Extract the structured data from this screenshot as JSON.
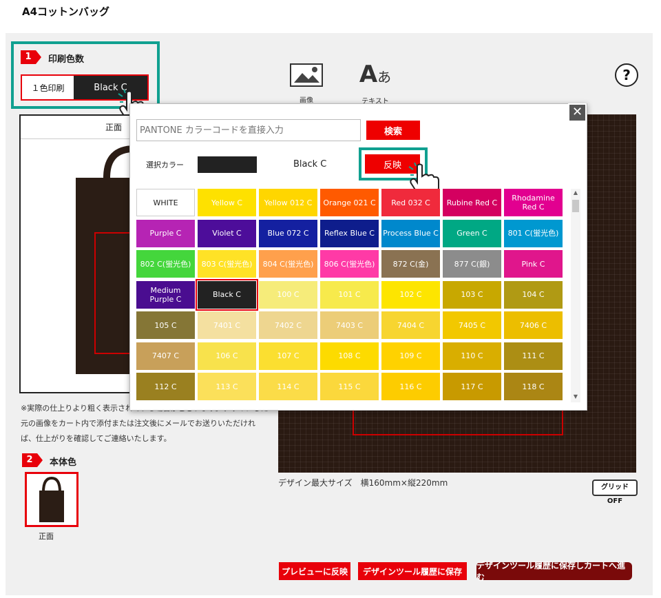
{
  "page": {
    "title": "A4コットンバッグ"
  },
  "step1": {
    "number": "1",
    "label": "印刷色数",
    "option_single": "１色印刷",
    "current_color": "Black C"
  },
  "step2": {
    "number": "2",
    "label": "本体色",
    "thumb_caption": "正面"
  },
  "tools": {
    "image_label": "画像",
    "text_label": "テキスト",
    "text_glyph": "A",
    "text_glyph_small": "あ",
    "help": "?"
  },
  "preview": {
    "tab_label": "正面"
  },
  "note": {
    "text": "※実際の仕上りより粗く表示されている場合がございます。デザインした元の画像をカート内で添付または注文後にメールでお送りいただければ、仕上がりを確認してご連絡いたします。"
  },
  "canvas": {
    "design_size": "デザイン最大サイズ　横160mm×縦220mm",
    "grid_button": "グリッドOFF"
  },
  "buttons": {
    "preview": "プレビューに反映",
    "save": "デザインツール履歴に保存",
    "save_cart": "デザインツール履歴に保存しカートへ進む"
  },
  "modal": {
    "close": "✕",
    "input_placeholder": "PANTONE カラーコードを直接入力",
    "search": "検索",
    "selected_label": "選択カラー",
    "selected_name": "Black C",
    "apply": "反映",
    "swatches": [
      {
        "label": "WHITE",
        "bg": "#ffffff",
        "fg": "#222222"
      },
      {
        "label": "Yellow C",
        "bg": "#fee100",
        "fg": "#ffffff"
      },
      {
        "label": "Yellow 012 C",
        "bg": "#ffd600",
        "fg": "#ffffff"
      },
      {
        "label": "Orange 021 C",
        "bg": "#ff5a00",
        "fg": "#ffffff"
      },
      {
        "label": "Red 032 C",
        "bg": "#f02a3c",
        "fg": "#ffffff"
      },
      {
        "label": "Rubine Red C",
        "bg": "#d40060",
        "fg": "#ffffff"
      },
      {
        "label": "Rhodamine Red C",
        "bg": "#e20090",
        "fg": "#ffffff"
      },
      {
        "label": "Purple C",
        "bg": "#b624b4",
        "fg": "#ffffff"
      },
      {
        "label": "Violet C",
        "bg": "#4d0d9a",
        "fg": "#ffffff"
      },
      {
        "label": "Blue 072 C",
        "bg": "#1420a0",
        "fg": "#ffffff"
      },
      {
        "label": "Reflex Blue C",
        "bg": "#0e1d8c",
        "fg": "#ffffff"
      },
      {
        "label": "Process Blue C",
        "bg": "#0088cc",
        "fg": "#ffffff"
      },
      {
        "label": "Green C",
        "bg": "#00a884",
        "fg": "#ffffff"
      },
      {
        "label": "801 C(蛍光色)",
        "bg": "#0098d0",
        "fg": "#ffffff"
      },
      {
        "label": "802 C(蛍光色)",
        "bg": "#44d63c",
        "fg": "#ffffff"
      },
      {
        "label": "803 C(蛍光色)",
        "bg": "#ffe226",
        "fg": "#ffffff"
      },
      {
        "label": "804 C(蛍光色)",
        "bg": "#ffa04c",
        "fg": "#ffffff"
      },
      {
        "label": "806 C(蛍光色)",
        "bg": "#ff3aa6",
        "fg": "#ffffff"
      },
      {
        "label": "872 C(金)",
        "bg": "#8a7252",
        "fg": "#ffffff"
      },
      {
        "label": "877 C(銀)",
        "bg": "#8c8c8c",
        "fg": "#ffffff"
      },
      {
        "label": "Pink C",
        "bg": "#e0168c",
        "fg": "#ffffff"
      },
      {
        "label": "Medium Purple C",
        "bg": "#4a0d90",
        "fg": "#ffffff"
      },
      {
        "label": "Black C",
        "bg": "#222222",
        "fg": "#ffffff"
      },
      {
        "label": "100 C",
        "bg": "#f6ec7a",
        "fg": "#ffffff"
      },
      {
        "label": "101 C",
        "bg": "#f7ea4c",
        "fg": "#ffffff"
      },
      {
        "label": "102 C",
        "bg": "#fde500",
        "fg": "#ffffff"
      },
      {
        "label": "103 C",
        "bg": "#c8a800",
        "fg": "#ffffff"
      },
      {
        "label": "104 C",
        "bg": "#b09a14",
        "fg": "#ffffff"
      },
      {
        "label": "105 C",
        "bg": "#857636",
        "fg": "#ffffff"
      },
      {
        "label": "7401 C",
        "bg": "#f4e0a0",
        "fg": "#ffffff"
      },
      {
        "label": "7402 C",
        "bg": "#eed690",
        "fg": "#ffffff"
      },
      {
        "label": "7403 C",
        "bg": "#eccd78",
        "fg": "#ffffff"
      },
      {
        "label": "7404 C",
        "bg": "#f7d530",
        "fg": "#ffffff"
      },
      {
        "label": "7405 C",
        "bg": "#f2c800",
        "fg": "#ffffff"
      },
      {
        "label": "7406 C",
        "bg": "#ecbe00",
        "fg": "#ffffff"
      },
      {
        "label": "7407 C",
        "bg": "#c8a05a",
        "fg": "#ffffff"
      },
      {
        "label": "106 C",
        "bg": "#f8e24c",
        "fg": "#ffffff"
      },
      {
        "label": "107 C",
        "bg": "#fbdf30",
        "fg": "#ffffff"
      },
      {
        "label": "108 C",
        "bg": "#fddb00",
        "fg": "#ffffff"
      },
      {
        "label": "109 C",
        "bg": "#ffd200",
        "fg": "#ffffff"
      },
      {
        "label": "110 C",
        "bg": "#d9ae00",
        "fg": "#ffffff"
      },
      {
        "label": "111 C",
        "bg": "#ac8e14",
        "fg": "#ffffff"
      },
      {
        "label": "112 C",
        "bg": "#9a8020",
        "fg": "#ffffff"
      },
      {
        "label": "113 C",
        "bg": "#fbe05a",
        "fg": "#ffffff"
      },
      {
        "label": "114 C",
        "bg": "#fbdc48",
        "fg": "#ffffff"
      },
      {
        "label": "115 C",
        "bg": "#fbd83c",
        "fg": "#ffffff"
      },
      {
        "label": "116 C",
        "bg": "#fdcc00",
        "fg": "#ffffff"
      },
      {
        "label": "117 C",
        "bg": "#c89a00",
        "fg": "#ffffff"
      },
      {
        "label": "118 C",
        "bg": "#ab8614",
        "fg": "#ffffff"
      }
    ]
  }
}
